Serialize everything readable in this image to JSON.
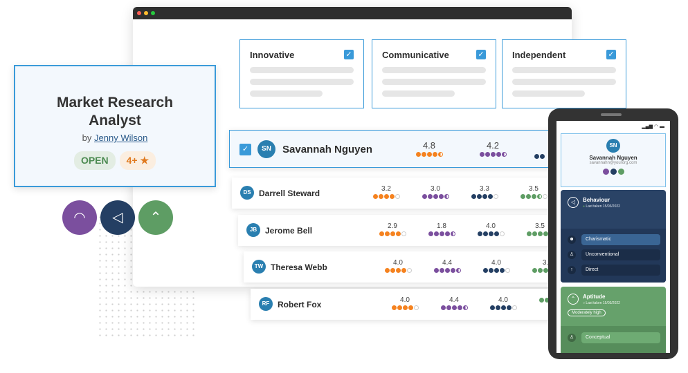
{
  "colors": {
    "accent": "#3a9ad9",
    "orange": "#f5821f",
    "purple": "#7b4f9e",
    "navy": "#243f63",
    "green": "#5e9d64"
  },
  "traits": [
    {
      "label": "Innovative"
    },
    {
      "label": "Communicative"
    },
    {
      "label": "Independent"
    }
  ],
  "job": {
    "title_line1": "Market Research",
    "title_line2": "Analyst",
    "by": "by",
    "author": "Jenny Wilson",
    "status": "OPEN",
    "rating": "4+ ★"
  },
  "selected": {
    "initials": "SN",
    "name": "Savannah Nguyen",
    "scores": [
      {
        "v": "4.8",
        "d": "ffffh"
      },
      {
        "v": "4.2",
        "d": "ffffh"
      }
    ]
  },
  "rows": [
    {
      "initials": "DS",
      "name": "Darrell Steward",
      "scores": [
        {
          "v": "3.2",
          "d": "ffffe"
        },
        {
          "v": "3.0",
          "d": "ffffh"
        },
        {
          "v": "3.3",
          "d": "ffffe"
        },
        {
          "v": "3.5",
          "d": "fffhe"
        }
      ]
    },
    {
      "initials": "JB",
      "name": "Jerome Bell",
      "scores": [
        {
          "v": "2.9",
          "d": "ffffe"
        },
        {
          "v": "1.8",
          "d": "ffffh"
        },
        {
          "v": "4.0",
          "d": "ffffe"
        },
        {
          "v": "3.5",
          "d": "ffffe"
        }
      ]
    },
    {
      "initials": "TW",
      "name": "Theresa Webb",
      "scores": [
        {
          "v": "4.0",
          "d": "ffffe"
        },
        {
          "v": "4.4",
          "d": "ffffh"
        },
        {
          "v": "4.0",
          "d": "ffffe"
        },
        {
          "v": "3.",
          "d": "ffffe"
        }
      ]
    },
    {
      "initials": "RF",
      "name": "Robert Fox",
      "scores": [
        {
          "v": "4.0",
          "d": "ffffe"
        },
        {
          "v": "4.4",
          "d": "ffffh"
        },
        {
          "v": "4.0",
          "d": "ffffe"
        },
        {
          "v": "",
          "d": "ffffe"
        }
      ]
    }
  ],
  "phone": {
    "initials": "SN",
    "name": "Savannah Nguyen",
    "email": "savannahn@yourorg.com",
    "behaviour": {
      "title": "Behaviour",
      "last": "Last taken 15/03/2022",
      "items": [
        "Charismatic",
        "Unconventional",
        "Direct"
      ]
    },
    "aptitude": {
      "title": "Aptitude",
      "last": "Last taken 15/03/2022",
      "badge": "Moderately high",
      "items": [
        "Conceptual"
      ]
    }
  }
}
